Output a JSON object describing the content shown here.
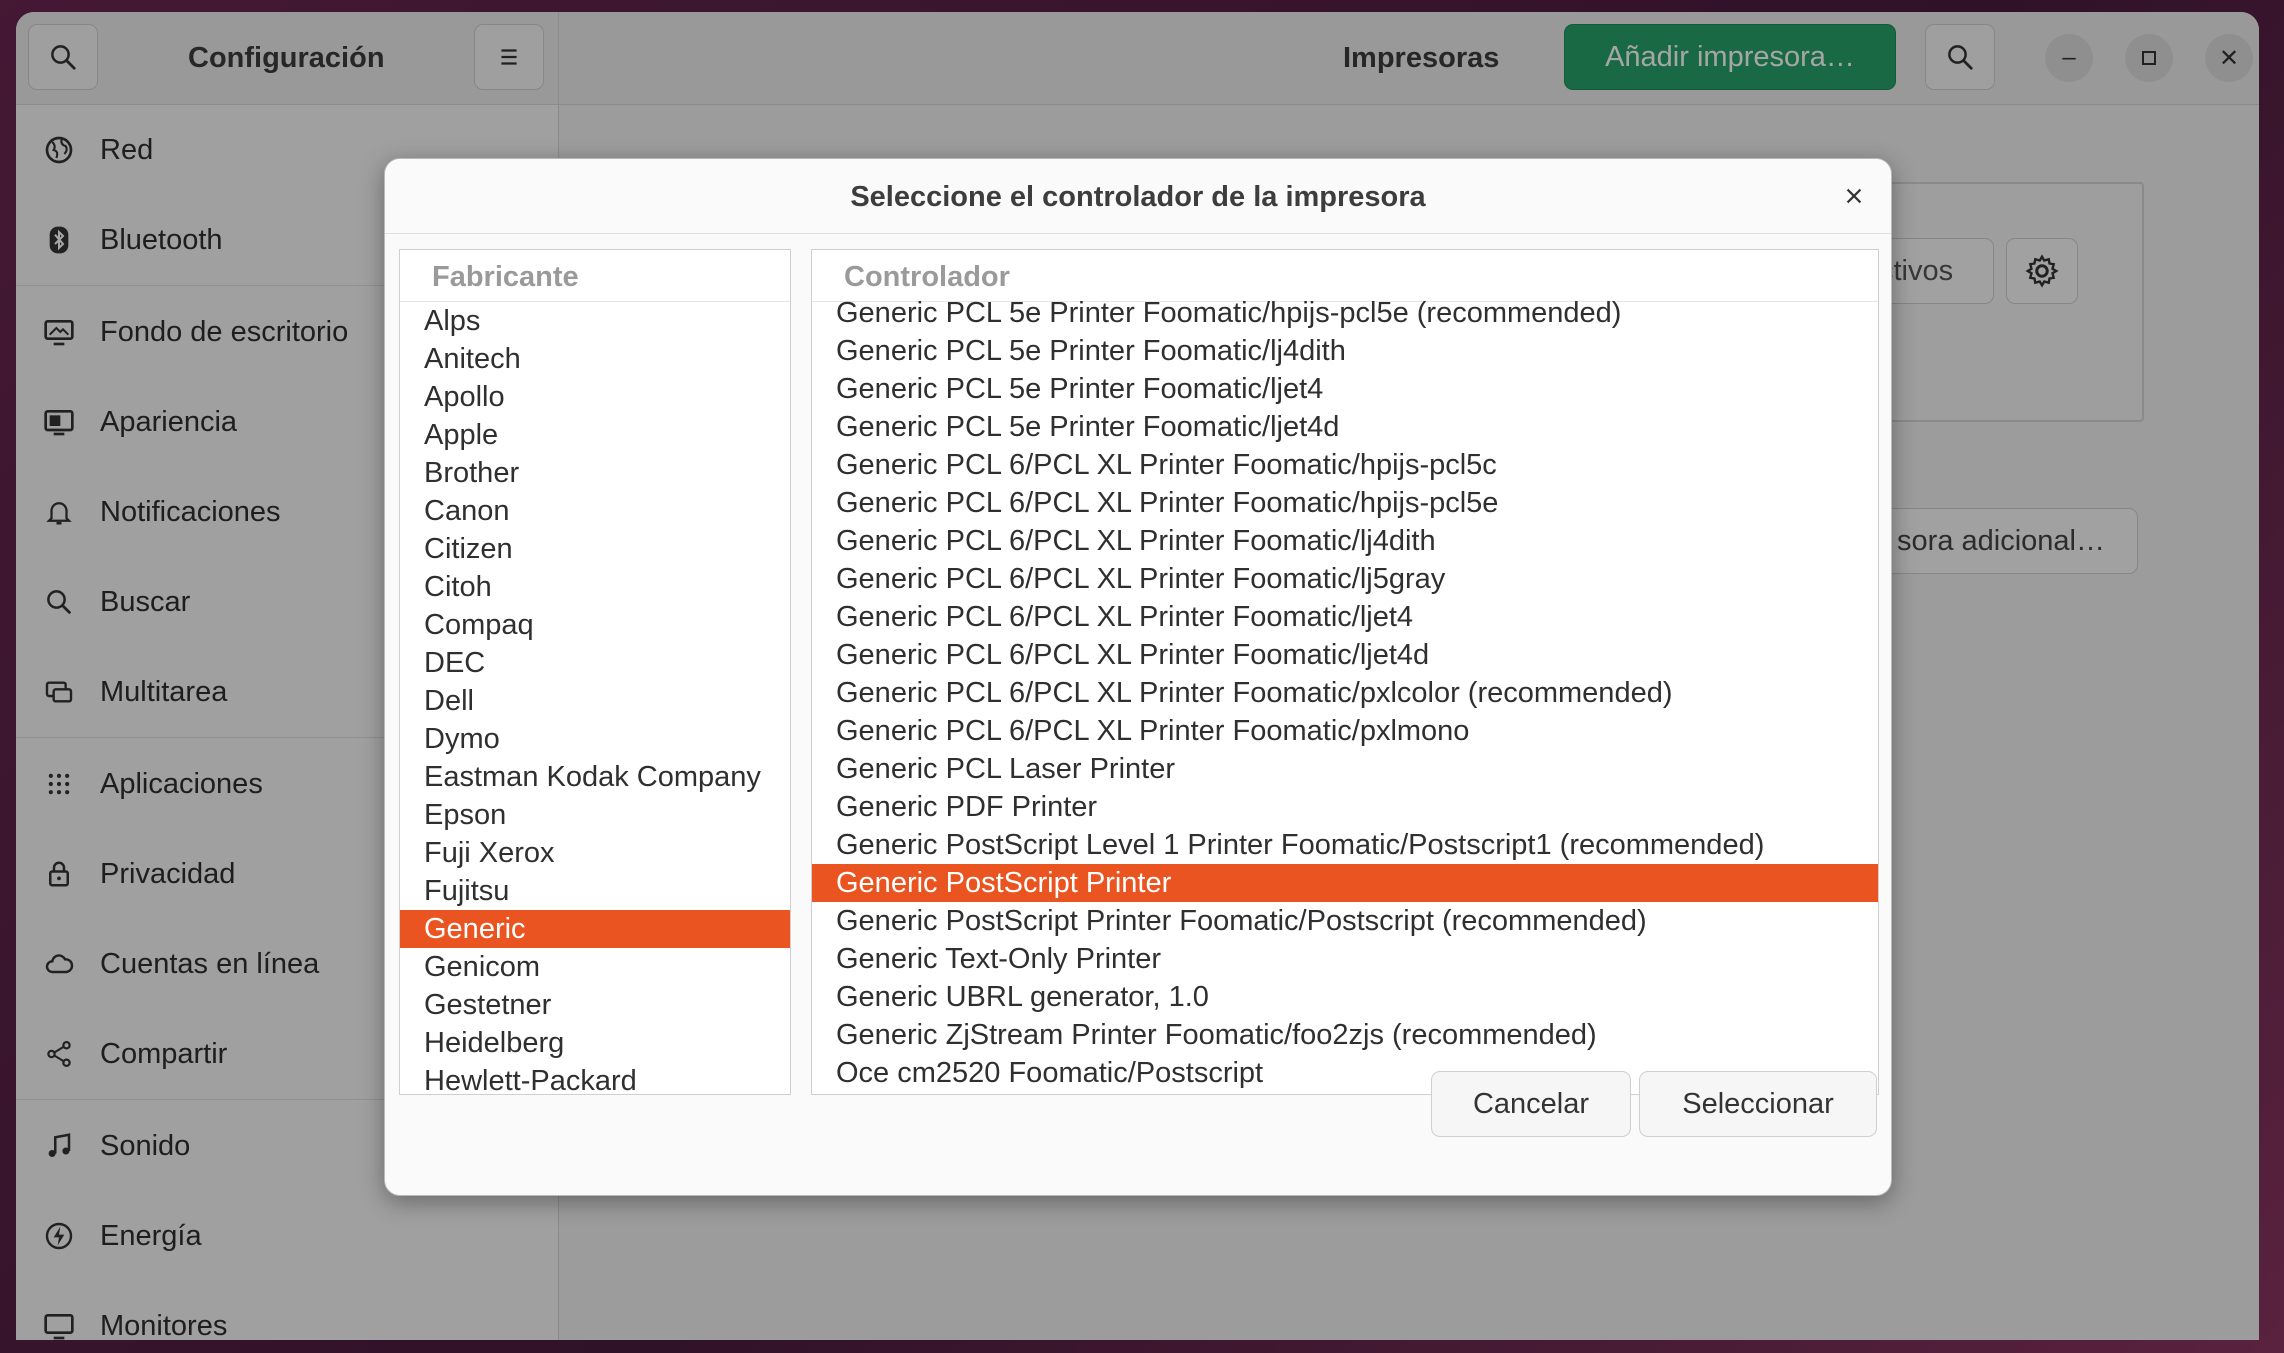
{
  "sidebar_header": {
    "title": "Configuración"
  },
  "main_header": {
    "title": "Impresoras",
    "add_printer_label": "Añadir impresora…"
  },
  "sidebar": {
    "items": [
      {
        "label": "Red",
        "icon": "globe-icon"
      },
      {
        "label": "Bluetooth",
        "icon": "bluetooth-icon"
      },
      {
        "label": "Fondo de escritorio",
        "icon": "monitor-icon"
      },
      {
        "label": "Apariencia",
        "icon": "appearance-icon"
      },
      {
        "label": "Notificaciones",
        "icon": "bell-icon"
      },
      {
        "label": "Buscar",
        "icon": "search-icon"
      },
      {
        "label": "Multitarea",
        "icon": "multitask-icon"
      },
      {
        "label": "Aplicaciones",
        "icon": "grid-icon"
      },
      {
        "label": "Privacidad",
        "icon": "lock-icon"
      },
      {
        "label": "Cuentas en línea",
        "icon": "cloud-icon"
      },
      {
        "label": "Compartir",
        "icon": "share-icon"
      },
      {
        "label": "Sonido",
        "icon": "music-note-icon"
      },
      {
        "label": "Energía",
        "icon": "power-icon"
      },
      {
        "label": "Monitores",
        "icon": "display-icon"
      }
    ]
  },
  "background": {
    "partial_button_1": "ctivos",
    "partial_button_2": "sora adicional…"
  },
  "dialog": {
    "title": "Seleccione el controlador de la impresora",
    "manufacturer_header": "Fabricante",
    "driver_header": "Controlador",
    "manufacturers": [
      "Alps",
      "Anitech",
      "Apollo",
      "Apple",
      "Brother",
      "Canon",
      "Citizen",
      "Citoh",
      "Compaq",
      "DEC",
      "Dell",
      "Dymo",
      "Eastman Kodak Company",
      "Epson",
      "Fuji Xerox",
      "Fujitsu",
      "Generic",
      "Genicom",
      "Gestetner",
      "Heidelberg",
      "Hewlett-Packard"
    ],
    "selected_manufacturer": "Generic",
    "drivers": [
      "Generic PCL 5e Printer Foomatic/hpijs-pcl5e (recommended)",
      "Generic PCL 5e Printer Foomatic/lj4dith",
      "Generic PCL 5e Printer Foomatic/ljet4",
      "Generic PCL 5e Printer Foomatic/ljet4d",
      "Generic PCL 6/PCL XL Printer Foomatic/hpijs-pcl5c",
      "Generic PCL 6/PCL XL Printer Foomatic/hpijs-pcl5e",
      "Generic PCL 6/PCL XL Printer Foomatic/lj4dith",
      "Generic PCL 6/PCL XL Printer Foomatic/lj5gray",
      "Generic PCL 6/PCL XL Printer Foomatic/ljet4",
      "Generic PCL 6/PCL XL Printer Foomatic/ljet4d",
      "Generic PCL 6/PCL XL Printer Foomatic/pxlcolor (recommended)",
      "Generic PCL 6/PCL XL Printer Foomatic/pxlmono",
      "Generic PCL Laser Printer",
      "Generic PDF Printer",
      "Generic PostScript Level 1 Printer Foomatic/Postscript1 (recommended)",
      "Generic PostScript Printer",
      "Generic PostScript Printer Foomatic/Postscript (recommended)",
      "Generic Text-Only Printer",
      "Generic UBRL generator, 1.0",
      "Generic ZjStream Printer Foomatic/foo2zjs (recommended)",
      "Oce cm2520 Foomatic/Postscript"
    ],
    "selected_driver": "Generic PostScript Printer",
    "cancel_label": "Cancelar",
    "select_label": "Seleccionar"
  },
  "colors": {
    "accent": "#e95420",
    "add_button": "#26a269"
  }
}
